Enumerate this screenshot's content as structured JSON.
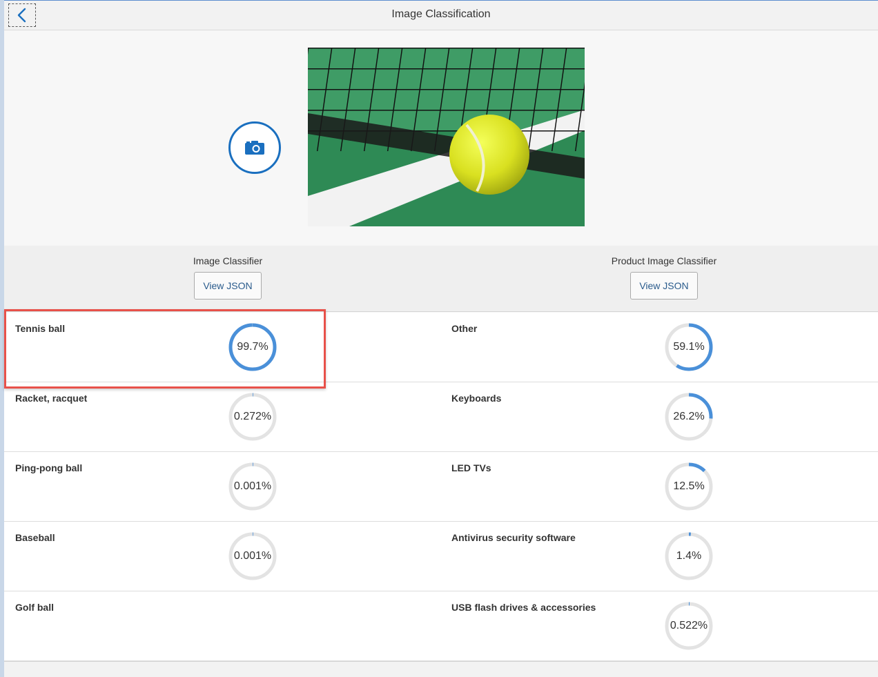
{
  "header": {
    "title": "Image Classification"
  },
  "classifiers": [
    {
      "title": "Image Classifier",
      "button_label": "View JSON"
    },
    {
      "title": "Product Image Classifier",
      "button_label": "View JSON"
    }
  ],
  "results": {
    "image_classifier": [
      {
        "label": "Tennis ball",
        "value_text": "99.7%",
        "fraction": 0.997
      },
      {
        "label": "Racket, racquet",
        "value_text": "0.272%",
        "fraction": 0.00272
      },
      {
        "label": "Ping-pong ball",
        "value_text": "0.001%",
        "fraction": 1e-05
      },
      {
        "label": "Baseball",
        "value_text": "0.001%",
        "fraction": 1e-05
      },
      {
        "label": "Golf ball",
        "value_text": "",
        "fraction": null
      }
    ],
    "product_image_classifier": [
      {
        "label": "Other",
        "value_text": "59.1%",
        "fraction": 0.591
      },
      {
        "label": "Keyboards",
        "value_text": "26.2%",
        "fraction": 0.262
      },
      {
        "label": "LED TVs",
        "value_text": "12.5%",
        "fraction": 0.125
      },
      {
        "label": "Antivirus security software",
        "value_text": "1.4%",
        "fraction": 0.014
      },
      {
        "label": "USB flash drives & accessories",
        "value_text": "0.522%",
        "fraction": 0.00522
      }
    ]
  },
  "colors": {
    "accent": "#1a6fbf",
    "ring_fill": "#4a90d9",
    "ring_track": "#e3e3e3",
    "highlight": "#e8514a"
  },
  "icons": {
    "back": "chevron-left-icon",
    "camera": "camera-icon"
  }
}
